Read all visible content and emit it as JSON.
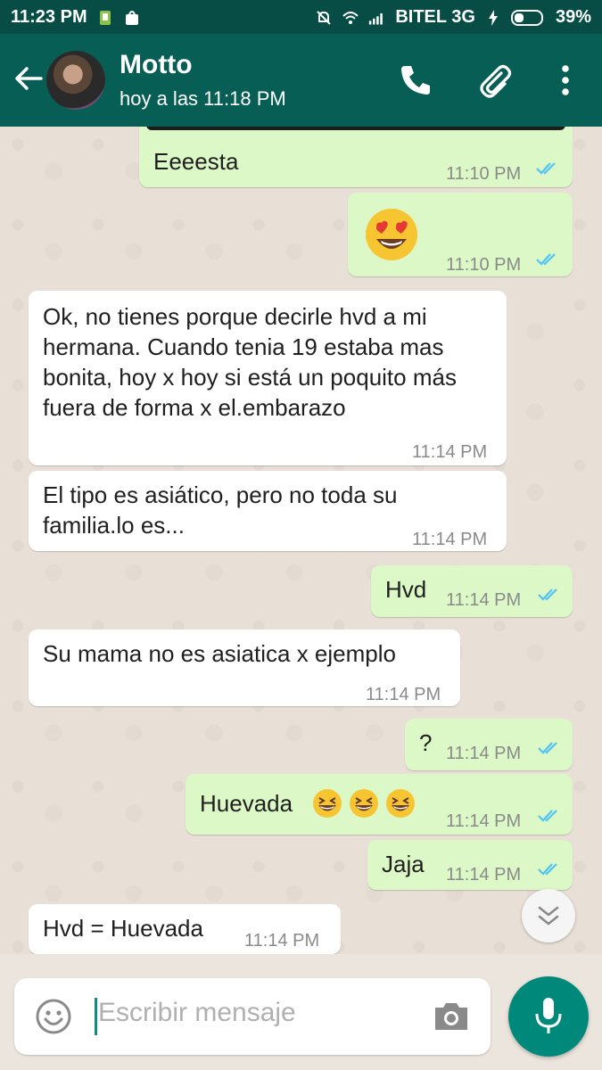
{
  "status_bar": {
    "time": "11:23 PM",
    "carrier": "BITEL 3G",
    "battery": "39%"
  },
  "header": {
    "contact_name": "Motto",
    "last_seen": "hoy a las 11:18 PM"
  },
  "messages": [
    {
      "direction": "out",
      "text": "Eeeesta",
      "time": "11:10 PM",
      "read": true
    },
    {
      "direction": "out",
      "text": "",
      "emoji": "heart-eyes",
      "time": "11:10 PM",
      "read": true
    },
    {
      "direction": "in",
      "text": "Ok, no tienes porque decirle hvd a mi hermana. Cuando tenia 19 estaba mas bonita, hoy x hoy si está un poquito más fuera de forma x el.embarazo",
      "time": "11:14 PM"
    },
    {
      "direction": "in",
      "text": "El tipo es asiático, pero no toda su familia.lo es...",
      "time": "11:14 PM"
    },
    {
      "direction": "out",
      "text": "Hvd",
      "time": "11:14 PM",
      "read": true
    },
    {
      "direction": "in",
      "text": "Su mama no es asiatica x ejemplo",
      "time": "11:14 PM"
    },
    {
      "direction": "out",
      "text": "?",
      "time": "11:14 PM",
      "read": true
    },
    {
      "direction": "out",
      "text": "Huevada",
      "emoji": "laughing x3",
      "time": "11:14 PM",
      "read": true
    },
    {
      "direction": "out",
      "text": "Jaja",
      "time": "11:14 PM",
      "read": true
    },
    {
      "direction": "in",
      "text": "Hvd = Huevada",
      "time": "11:14 PM"
    }
  ],
  "composer": {
    "placeholder": "Escribir mensaje"
  },
  "colors": {
    "header": "#075e54",
    "status_bar": "#084d45",
    "outgoing_bubble": "#dcf8c6",
    "incoming_bubble": "#ffffff",
    "read_tick": "#4fc3f7",
    "mic_button": "#00897b"
  },
  "icons": [
    "back-arrow-icon",
    "phone-icon",
    "attach-icon",
    "more-vert-icon",
    "emoji-icon",
    "camera-icon",
    "mic-icon",
    "double-chevron-down-icon"
  ]
}
